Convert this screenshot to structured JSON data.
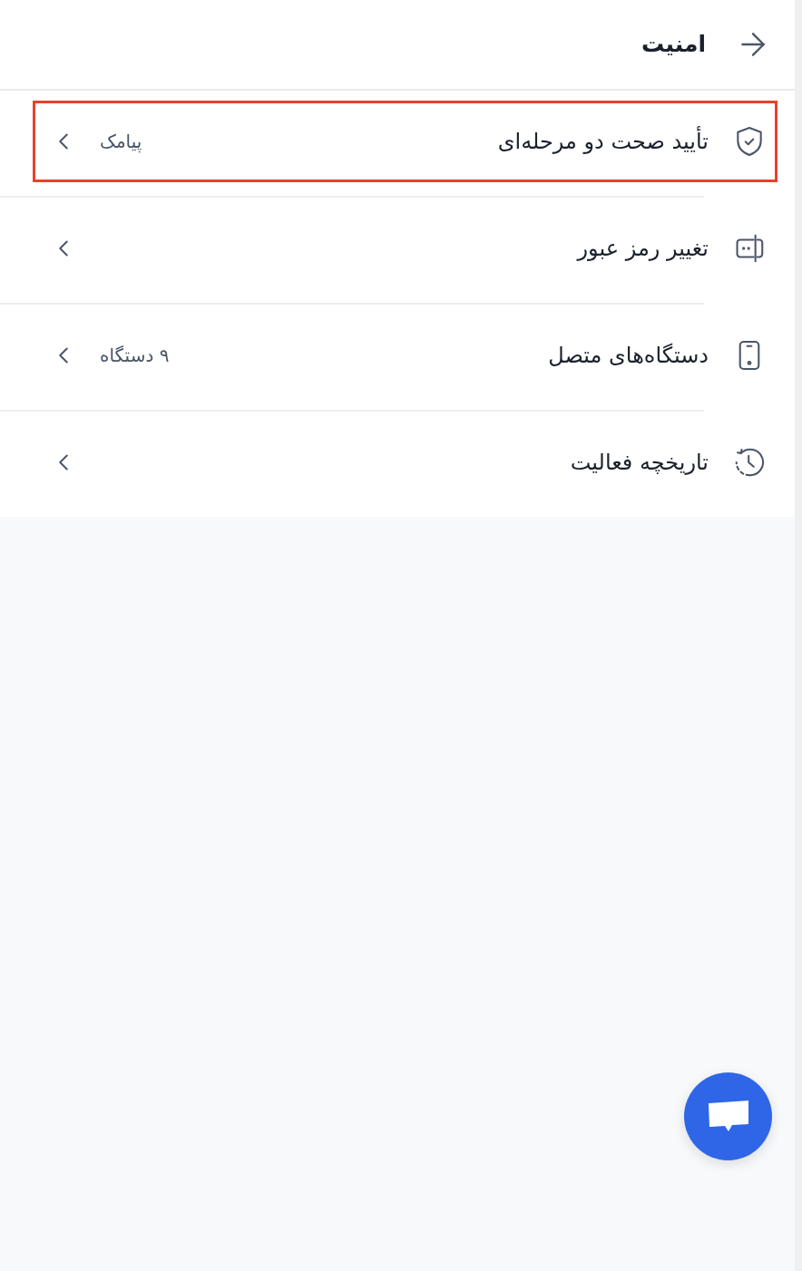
{
  "header": {
    "title": "امنیت"
  },
  "items": [
    {
      "label": "تأیید صحت دو مرحله‌ای",
      "value": "پیامک",
      "selected": true
    },
    {
      "label": "تغییر رمز عبور",
      "selected": false
    },
    {
      "label": "دستگاه‌های متصل",
      "value": "۹ دستگاه",
      "selected": false
    },
    {
      "label": "تاریخچه فعالیت",
      "selected": false
    }
  ]
}
